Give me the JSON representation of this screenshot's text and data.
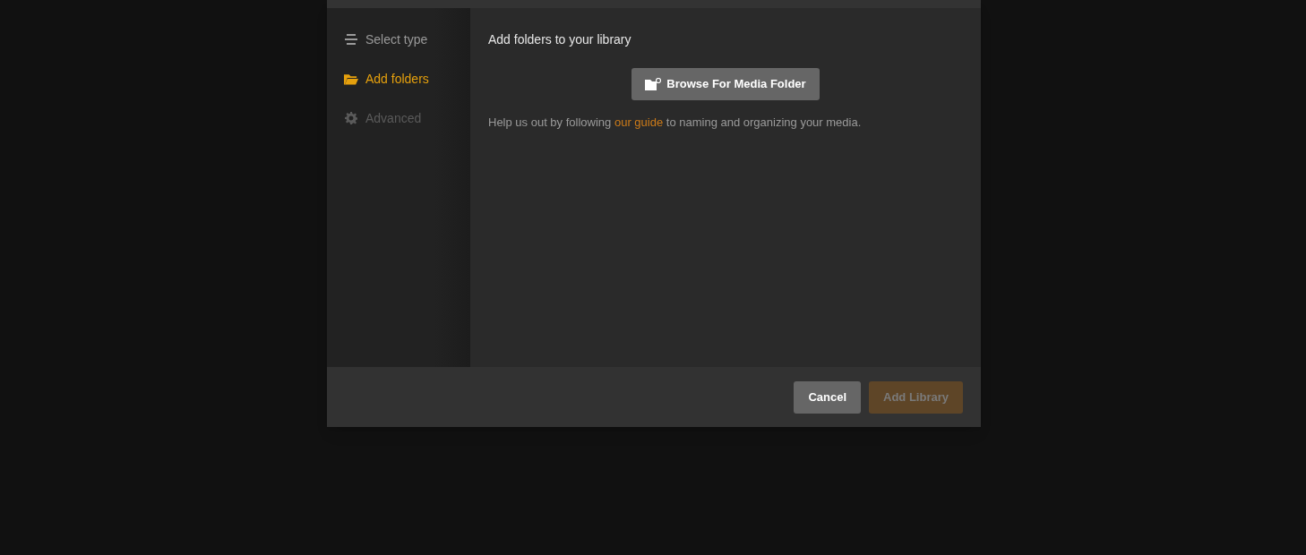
{
  "steps": [
    {
      "label": "Select type",
      "kind": "list",
      "selected": false,
      "disabled": false
    },
    {
      "label": "Add folders",
      "kind": "folder",
      "selected": true,
      "disabled": false
    },
    {
      "label": "Advanced",
      "kind": "gear",
      "selected": false,
      "disabled": true
    }
  ],
  "content": {
    "heading": "Add folders to your library",
    "browse_button": "Browse For Media Folder",
    "help_before": "Help us out by following",
    "help_link": "our guide",
    "help_after": "to naming and organizing your media."
  },
  "footer": {
    "buttons": [
      {
        "label": "Cancel",
        "disabled": false
      },
      {
        "label": "Add Library",
        "disabled": true
      }
    ]
  }
}
